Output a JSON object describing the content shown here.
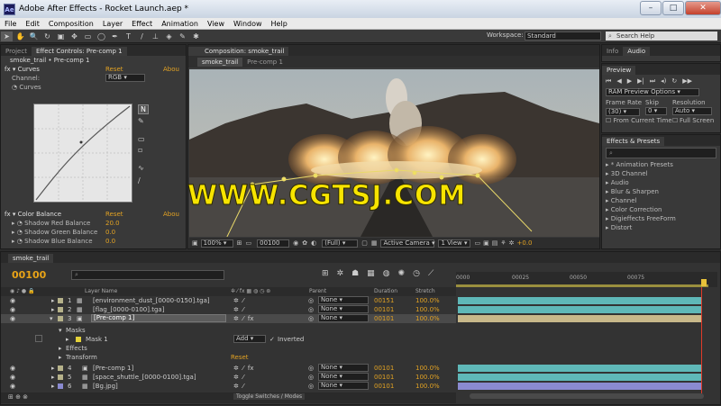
{
  "window": {
    "title": "Adobe After Effects - Rocket Launch.aep *",
    "app_icon_text": "Ae",
    "minimize": "–",
    "maximize": "□",
    "close": "✕"
  },
  "menu": [
    "File",
    "Edit",
    "Composition",
    "Layer",
    "Effect",
    "Animation",
    "View",
    "Window",
    "Help"
  ],
  "toolbar": {
    "workspace_label": "Workspace:",
    "workspace_value": "Standard",
    "search_placeholder": "Search Help"
  },
  "project_panel": {
    "tab_project": "Project",
    "tab_effect_controls": "Effect Controls: Pre-comp 1",
    "header_path": "smoke_trail • Pre-comp 1",
    "curves": {
      "effect_name": "Curves",
      "reset": "Reset",
      "about": "Abou",
      "channel_label": "Channel:",
      "channel_value": "RGB",
      "curves_label": "Curves"
    },
    "color_balance": {
      "effect_name": "Color Balance",
      "reset": "Reset",
      "about": "Abou",
      "params": [
        {
          "label": "Shadow Red Balance",
          "value": "20.0"
        },
        {
          "label": "Shadow Green Balance",
          "value": "0.0"
        },
        {
          "label": "Shadow Blue Balance",
          "value": "0.0"
        }
      ]
    }
  },
  "composition": {
    "tab_title": "Composition: smoke_trail",
    "sub_tab_1": "smoke_trail",
    "sub_tab_2": "Pre-comp 1",
    "zoom": "100%",
    "timecode": "00100",
    "resolution": "(Full)",
    "camera": "Active Camera",
    "view": "1 View",
    "exposure": "+0.0"
  },
  "watermark": "WWW.CGTSJ.COM",
  "right_panels": {
    "info_tab": "Info",
    "audio_tab": "Audio",
    "preview_tab": "Preview",
    "ram_preview": "RAM Preview Options",
    "frame_rate_label": "Frame Rate",
    "skip_label": "Skip",
    "resolution_label": "Resolution",
    "frame_rate_value": "(30)",
    "skip_value": "0",
    "resolution_value": "Auto",
    "from_current": "From Current Time",
    "full_screen": "Full Screen",
    "effects_tab": "Effects & Presets",
    "effects": [
      "* Animation Presets",
      "3D Channel",
      "Audio",
      "Blur & Sharpen",
      "Channel",
      "Color Correction",
      "Digieffects FreeForm",
      "Distort"
    ]
  },
  "timeline": {
    "tab": "smoke_trail",
    "timecode": "00100",
    "col_layer_name": "Layer Name",
    "col_parent": "Parent",
    "col_duration": "Duration",
    "col_stretch": "Stretch",
    "ruler_marks": [
      "0000",
      "00025",
      "00050",
      "00075"
    ],
    "layers": [
      {
        "num": "1",
        "name": "[environment_dust_[0000-0150].tga]",
        "parent": "None",
        "duration": "00151",
        "stretch": "100.0%",
        "color": "#5fb8b8"
      },
      {
        "num": "2",
        "name": "[flag_[0000-0100].tga]",
        "parent": "None",
        "duration": "00101",
        "stretch": "100.0%",
        "color": "#5fb8b8"
      },
      {
        "num": "3",
        "name": "[Pre-comp 1]",
        "parent": "None",
        "duration": "00101",
        "stretch": "100.0%",
        "color": "#c8b88a"
      }
    ],
    "masks_label": "Masks",
    "mask1_label": "Mask 1",
    "mask_mode": "Add",
    "inverted_label": "Inverted",
    "effects_label": "Effects",
    "transform_label": "Transform",
    "transform_reset": "Reset",
    "layers_lower": [
      {
        "num": "4",
        "name": "[Pre-comp 1]",
        "parent": "None",
        "duration": "00101",
        "stretch": "100.0%",
        "color": "#5fb8b8"
      },
      {
        "num": "5",
        "name": "[space_shuttle_[0000-0100].tga]",
        "parent": "None",
        "duration": "00101",
        "stretch": "100.0%",
        "color": "#5fb8b8"
      },
      {
        "num": "6",
        "name": "[Bg.jpg]",
        "parent": "None",
        "duration": "00101",
        "stretch": "100.0%",
        "color": "#8a8ad0"
      }
    ],
    "toggle_label": "Toggle Switches / Modes"
  }
}
